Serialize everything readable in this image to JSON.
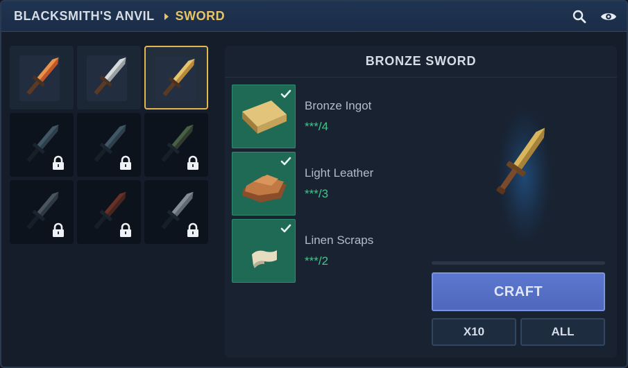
{
  "header": {
    "breadcrumb_root": "BLACKSMITH'S ANVIL",
    "breadcrumb_current": "SWORD",
    "icons": [
      "search-icon",
      "eye-icon"
    ]
  },
  "item_grid": [
    {
      "id": "slot-1",
      "locked": false,
      "selected": false,
      "colors": [
        "#c0562a",
        "#e8934a"
      ]
    },
    {
      "id": "slot-2",
      "locked": false,
      "selected": false,
      "colors": [
        "#9aa0a4",
        "#d6dadb"
      ]
    },
    {
      "id": "slot-3",
      "locked": false,
      "selected": true,
      "colors": [
        "#b8893a",
        "#e5c46b"
      ]
    },
    {
      "id": "slot-4",
      "locked": true,
      "selected": false,
      "colors": [
        "#3a4d5a",
        "#52707e"
      ]
    },
    {
      "id": "slot-5",
      "locked": true,
      "selected": false,
      "colors": [
        "#3a4d5a",
        "#52707e"
      ]
    },
    {
      "id": "slot-6",
      "locked": true,
      "selected": false,
      "colors": [
        "#3d4a38",
        "#5d7a50"
      ]
    },
    {
      "id": "slot-7",
      "locked": true,
      "selected": false,
      "colors": [
        "#3a4652",
        "#5d6b78"
      ]
    },
    {
      "id": "slot-8",
      "locked": true,
      "selected": false,
      "colors": [
        "#5a2a22",
        "#8a3a2c"
      ]
    },
    {
      "id": "slot-9",
      "locked": true,
      "selected": false,
      "colors": [
        "#7a8690",
        "#aeb6bc"
      ]
    }
  ],
  "detail": {
    "title": "BRONZE SWORD",
    "ingredients": [
      {
        "name": "Bronze Ingot",
        "count": "***/4",
        "icon": "bronze-ingot-icon"
      },
      {
        "name": "Light Leather",
        "count": "***/3",
        "icon": "leather-icon"
      },
      {
        "name": "Linen Scraps",
        "count": "***/2",
        "icon": "linen-icon"
      }
    ],
    "craft_label": "CRAFT",
    "x10_label": "X10",
    "all_label": "ALL"
  },
  "colors": {
    "accent_gold": "#e7c46a",
    "craft_blue": "#5c77cf",
    "ingredient_green": "#1e6a55",
    "count_green": "#3ec88a"
  }
}
